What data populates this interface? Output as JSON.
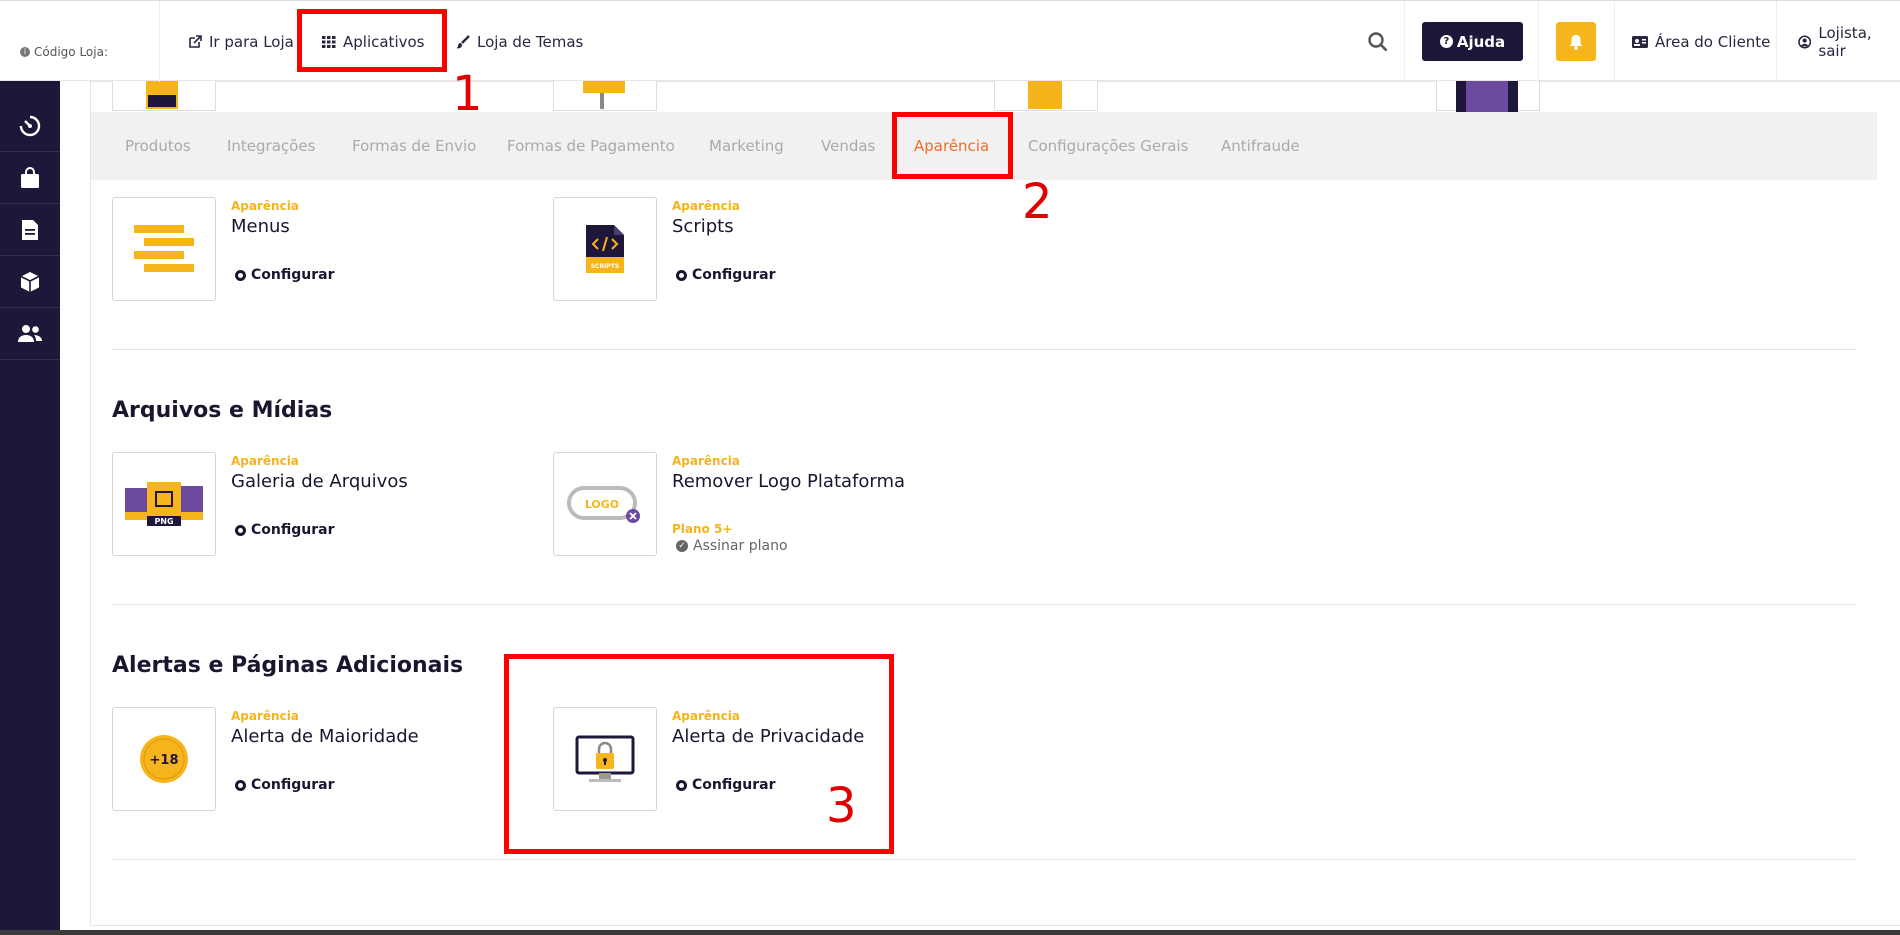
{
  "topbar": {
    "store_code_label": "Código Loja:",
    "nav": [
      {
        "label": "Ir para Loja",
        "icon": "external-link-icon"
      },
      {
        "label": "Aplicativos",
        "icon": "grid-icon"
      },
      {
        "label": "Loja de Temas",
        "icon": "brush-icon"
      }
    ],
    "help_label": "Ajuda",
    "client_area_label": "Área do Cliente",
    "user_label": "Lojista, sair"
  },
  "sidebar": {
    "items": [
      "dashboard-icon",
      "shopping-bag-icon",
      "document-icon",
      "box-icon",
      "users-icon"
    ]
  },
  "tabs": [
    {
      "label": "Produtos"
    },
    {
      "label": "Integrações"
    },
    {
      "label": "Formas de Envio"
    },
    {
      "label": "Formas de Pagamento"
    },
    {
      "label": "Marketing"
    },
    {
      "label": "Vendas"
    },
    {
      "label": "Aparência",
      "active": true
    },
    {
      "label": "Configurações Gerais"
    },
    {
      "label": "Antifraude"
    }
  ],
  "sections": [
    {
      "title": "",
      "cards": [
        {
          "category": "Aparência",
          "title": "Menus",
          "action": "Configurar",
          "icon": "menu-lines-icon"
        },
        {
          "category": "Aparência",
          "title": "Scripts",
          "action": "Configurar",
          "icon": "scripts-file-icon",
          "icon_text": "SCRIPTS"
        }
      ]
    },
    {
      "title": "Arquivos e Mídias",
      "cards": [
        {
          "category": "Aparência",
          "title": "Galeria de Arquivos",
          "action": "Configurar",
          "icon": "file-gallery-icon",
          "icon_text": "PNG"
        },
        {
          "category": "Aparência",
          "title": "Remover Logo Plataforma",
          "plan": "Plano 5+",
          "plan_action": "Assinar plano",
          "icon": "logo-remove-icon",
          "icon_text": "LOGO"
        }
      ]
    },
    {
      "title": "Alertas e Páginas Adicionais",
      "cards": [
        {
          "category": "Aparência",
          "title": "Alerta de Maioridade",
          "action": "Configurar",
          "icon": "age-18-icon",
          "icon_text": "+18"
        },
        {
          "category": "Aparência",
          "title": "Alerta de Privacidade",
          "action": "Configurar",
          "icon": "privacy-monitor-icon"
        }
      ]
    }
  ],
  "annotations": [
    "1",
    "2",
    "3"
  ],
  "colors": {
    "accent_yellow": "#f5b31c",
    "dark_navy": "#1f1739",
    "active_tab": "#f36c21",
    "highlight_red": "#ff0000"
  }
}
